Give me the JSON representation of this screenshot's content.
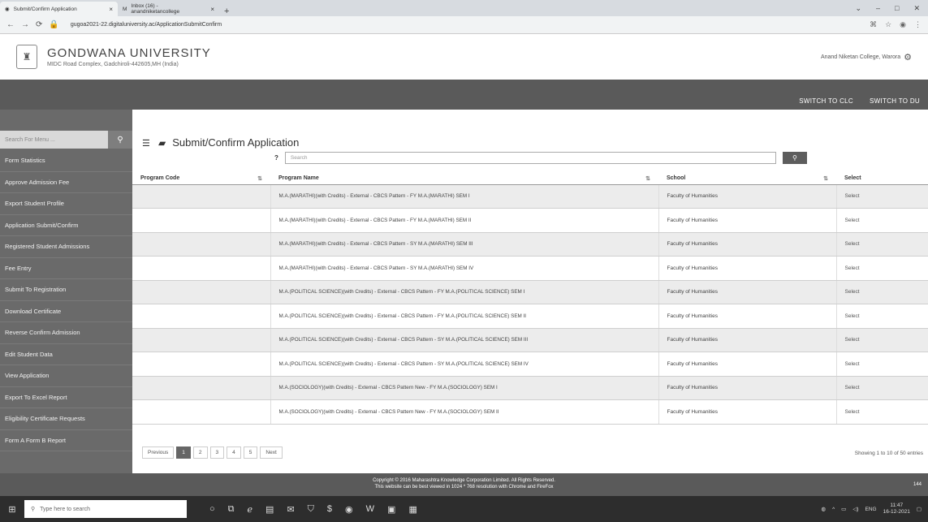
{
  "browser": {
    "tabs": [
      {
        "title": "Submit/Confirm Application",
        "active": true
      },
      {
        "title": "Inbox (16) - anandniketancollege",
        "active": false
      }
    ],
    "url": "gugoa2021-22.digitaluniversity.ac/ApplicationSubmitConfirm"
  },
  "header": {
    "university": "GONDWANA UNIVERSITY",
    "address": "MIDC Road Complex, Gadchiroli-442605,MH (India)",
    "college": "Anand Niketan College, Warora"
  },
  "topnav": {
    "switch_clc": "SWITCH TO CLC",
    "switch_du": "SWITCH TO DU"
  },
  "sidebar": {
    "search_placeholder": "Search For Menu ...",
    "items": [
      "Form Statistics",
      "Approve Admission Fee",
      "Export Student Profile",
      "Application Submit/Confirm",
      "Registered Student Admissions",
      "Fee Entry",
      "Submit To Registration",
      "Download Certificate",
      "Reverse Confirm Admission",
      "Edit Student Data",
      "View Application",
      "Export To Excel Report",
      "Eligibility Certificate Requests",
      "Form A Form B Report"
    ]
  },
  "main": {
    "title": "Submit/Confirm Application",
    "help": "?",
    "search_placeholder": "Search",
    "columns": [
      "Program Code",
      "Program Name",
      "School",
      "Select"
    ],
    "rows": [
      {
        "code": "",
        "name": "M.A.(MARATHI)(with Credits) - External - CBCS Pattern - FY M.A.(MARATHI) SEM I",
        "school": "Faculty of Humanities",
        "select": "Select"
      },
      {
        "code": "",
        "name": "M.A.(MARATHI)(with Credits) - External - CBCS Pattern - FY M.A.(MARATHI) SEM II",
        "school": "Faculty of Humanities",
        "select": "Select"
      },
      {
        "code": "",
        "name": "M.A.(MARATHI)(with Credits) - External - CBCS Pattern - SY M.A.(MARATHI) SEM III",
        "school": "Faculty of Humanities",
        "select": "Select"
      },
      {
        "code": "",
        "name": "M.A.(MARATHI)(with Credits) - External - CBCS Pattern - SY M.A.(MARATHI) SEM IV",
        "school": "Faculty of Humanities",
        "select": "Select"
      },
      {
        "code": "",
        "name": "M.A.(POLITICAL SCIENCE)(with Credits) - External - CBCS Pattern - FY M.A.(POLITICAL SCIENCE) SEM I",
        "school": "Faculty of Humanities",
        "select": "Select"
      },
      {
        "code": "",
        "name": "M.A.(POLITICAL SCIENCE)(with Credits) - External - CBCS Pattern - FY M.A.(POLITICAL SCIENCE) SEM II",
        "school": "Faculty of Humanities",
        "select": "Select"
      },
      {
        "code": "",
        "name": "M.A.(POLITICAL SCIENCE)(with Credits) - External - CBCS Pattern - SY M.A.(POLITICAL SCIENCE) SEM III",
        "school": "Faculty of Humanities",
        "select": "Select"
      },
      {
        "code": "",
        "name": "M.A.(POLITICAL SCIENCE)(with Credits) - External - CBCS Pattern - SY M.A.(POLITICAL SCIENCE) SEM IV",
        "school": "Faculty of Humanities",
        "select": "Select"
      },
      {
        "code": "",
        "name": "M.A.(SOCIOLOGY)(with Credits) - External - CBCS Pattern New - FY M.A.(SOCIOLOGY) SEM I",
        "school": "Faculty of Humanities",
        "select": "Select"
      },
      {
        "code": "",
        "name": "M.A.(SOCIOLOGY)(with Credits) - External - CBCS Pattern New - FY M.A.(SOCIOLOGY) SEM II",
        "school": "Faculty of Humanities",
        "select": "Select"
      }
    ],
    "pagination": {
      "previous": "Previous",
      "pages": [
        "1",
        "2",
        "3",
        "4",
        "5"
      ],
      "current": "1",
      "next": "Next"
    },
    "showing": "Showing 1 to 10 of 50 entries"
  },
  "footer": {
    "line1": "Copyright © 2016 Maharashtra Knowledge Corporation Limited. All Rights Reserved.",
    "line2": "This website can be best viewed in 1024 * 768 resolution with Chrome and FireFox",
    "right": "144"
  },
  "taskbar": {
    "search_placeholder": "Type here to search",
    "lang": "ENG",
    "time": "11:47",
    "date": "16-12-2021"
  }
}
